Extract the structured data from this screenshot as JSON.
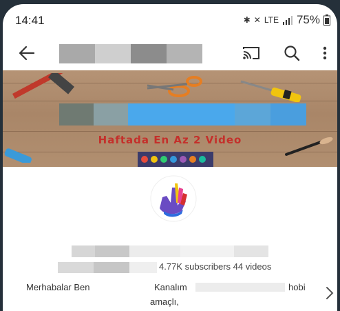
{
  "status_bar": {
    "time": "14:41",
    "battery": "75%",
    "network": "LTE"
  },
  "app_bar": {
    "back_icon": "arrow-left-icon",
    "cast_icon": "cast-icon",
    "search_icon": "search-icon",
    "more_icon": "more-vertical-icon"
  },
  "banner": {
    "tagline": "Haftada En Az 2 Video"
  },
  "channel": {
    "stats": "4.77K subscribers  44 videos",
    "description_parts": [
      "Merhabalar Ben",
      "Kanalım",
      "hobi",
      "amaçlı,"
    ]
  },
  "colors": {
    "banner_text": "#c4302b",
    "wood": "#ad8a6b",
    "blur_blue": "#4aa8ec"
  }
}
